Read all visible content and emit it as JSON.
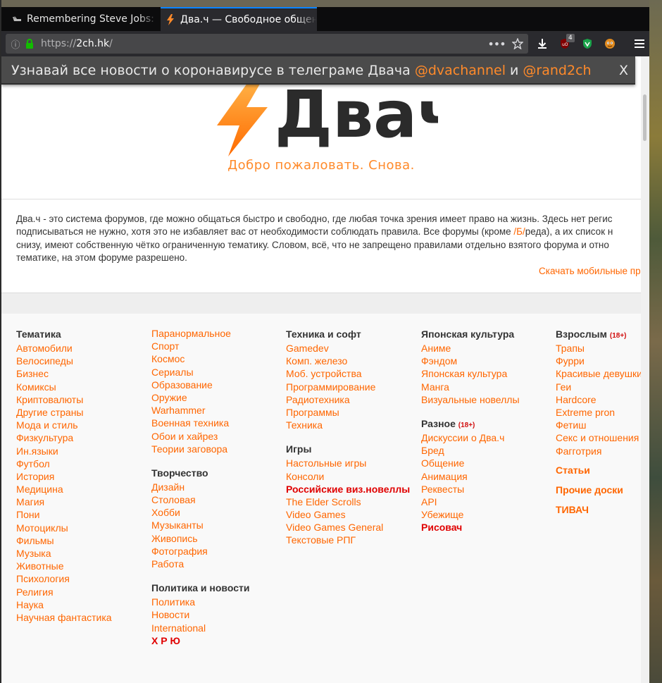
{
  "browser": {
    "tabs": [
      {
        "title": "Remembering Steve Jobs: Pl",
        "active": false
      },
      {
        "title": "Два.ч — Свободное общен",
        "active": true
      }
    ],
    "url_scheme": "https://",
    "url_host": "2ch.hk",
    "url_path": "/",
    "more_label": "•••",
    "ublock_badge": "4"
  },
  "notification": {
    "text_before": "Узнавай все новости о коронавирусе в телеграме Двача ",
    "link1": "@dvachannel",
    "text_mid": " и ",
    "link2": "@rand2ch",
    "close_label": "X"
  },
  "logo": {
    "text": "Двач"
  },
  "welcome": "Добро пожаловать. Снова.",
  "description": {
    "line1": "Два.ч - это система форумов, где можно общаться быстро и свободно, где любая точка зрения имеет право на жизнь. Здесь нет регис",
    "line2_before": "подписываться не нужно, хотя это не избавляет вас от необходимости соблюдать правила. Все форумы (кроме ",
    "line2_link": "/Б/",
    "line2_after": "реда), а их список н",
    "line3": "снизу, имеют собственную чётко ограниченную тематику. Словом, всё, что не запрещено правилами отдельно взятого форума и отно",
    "line4": "тематике, на этом форуме разрешено.",
    "mobile_link": "Скачать мобильные пр"
  },
  "boards": {
    "col1": {
      "head": "Тематика",
      "items": [
        "Автомобили",
        "Велосипеды",
        "Бизнес",
        "Комиксы",
        "Криптовалюты",
        "Другие страны",
        "Мода и стиль",
        "Физкультура",
        "Ин.языки",
        "Футбол",
        "История",
        "Медицина",
        "Магия",
        "Пони",
        "Мотоциклы",
        "Фильмы",
        "Музыка",
        "Животные",
        "Психология",
        "Религия",
        "Наука",
        "Научная фантастика"
      ]
    },
    "col2": {
      "items1": [
        "Паранормальное",
        "Спорт",
        "Космос",
        "Сериалы",
        "Образование",
        "Оружие",
        "Warhammer",
        "Военная техника",
        "Обои и хайрез",
        "Теории заговора"
      ],
      "head2": "Творчество",
      "items2": [
        "Дизайн",
        "Столовая",
        "Хобби",
        "Музыканты",
        "Живопись",
        "Фотография",
        "Работа"
      ],
      "head3": "Политика и новости",
      "items3": [
        "Политика",
        "Новости",
        "International"
      ],
      "hot3": "Х Р Ю"
    },
    "col3": {
      "head1": "Техника и софт",
      "items1": [
        "Gamedev",
        "Комп. железо",
        "Моб. устройства",
        "Программирование",
        "Радиотехника",
        "Программы",
        "Техника"
      ],
      "head2": "Игры",
      "items2a": [
        "Настольные игры",
        "Консоли"
      ],
      "hot2": "Российские виз.новеллы",
      "items2b": [
        "The Elder Scrolls",
        "Video Games",
        "Video Games General",
        "Текстовые РПГ"
      ]
    },
    "col4": {
      "head1": "Японская культура",
      "items1": [
        "Аниме",
        "Фэндом",
        "Японская культура",
        "Манга",
        "Визуальные новеллы"
      ],
      "head2": "Разное",
      "age2": "(18+)",
      "items2": [
        "Дискуссии о Два.ч",
        "Бред",
        "Общение",
        "Анимация",
        "Реквесты",
        "API",
        "Убежище"
      ],
      "hot2": "Рисовач"
    },
    "col5": {
      "head1": "Взрослым",
      "age1": "(18+)",
      "items1": [
        "Трапы",
        "Фурри",
        "Красивые девушки",
        "Геи",
        "Hardcore",
        "Extreme pron",
        "Фетиш",
        "Секс и отношения",
        "Фагготрия"
      ],
      "big": [
        "Статьи",
        "Прочие доски",
        "ТИВАЧ"
      ]
    }
  },
  "colors": {
    "accent": "#ff6600",
    "hot": "#e00000",
    "chrome": "#2a2a2e"
  }
}
